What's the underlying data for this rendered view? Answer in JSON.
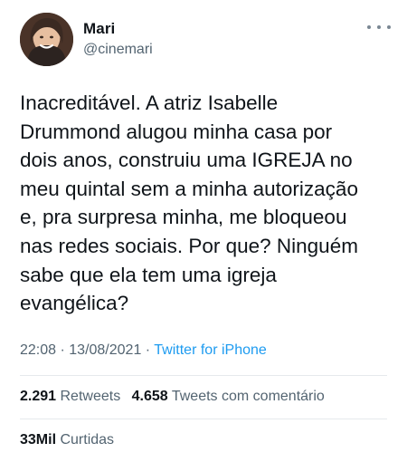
{
  "user": {
    "name": "Mari",
    "handle": "@cinemari"
  },
  "tweet": {
    "text": "Inacreditável. A atriz Isabelle\nDrummond alugou minha casa por\ndois anos, construiu uma IGREJA no\nmeu quintal sem a minha autorização\ne, pra surpresa minha, me bloqueou\nnas redes sociais. Por que? Ninguém\nsabe que ela tem uma igreja\nevangélica?",
    "time": "22:08",
    "separator": " · ",
    "date": "13/08/2021",
    "source": "Twitter for iPhone"
  },
  "stats": {
    "retweets_count": "2.291",
    "retweets_label": "Retweets",
    "quotes_count": "4.658",
    "quotes_label": "Tweets com comentário",
    "likes_count": "33Mil",
    "likes_label": "Curtidas"
  },
  "colors": {
    "text": "#0f1419",
    "secondary": "#536471",
    "link": "#1d9bf0",
    "divider": "#e6e9ec"
  },
  "icons": {
    "more": "more-horizontal-icon"
  }
}
